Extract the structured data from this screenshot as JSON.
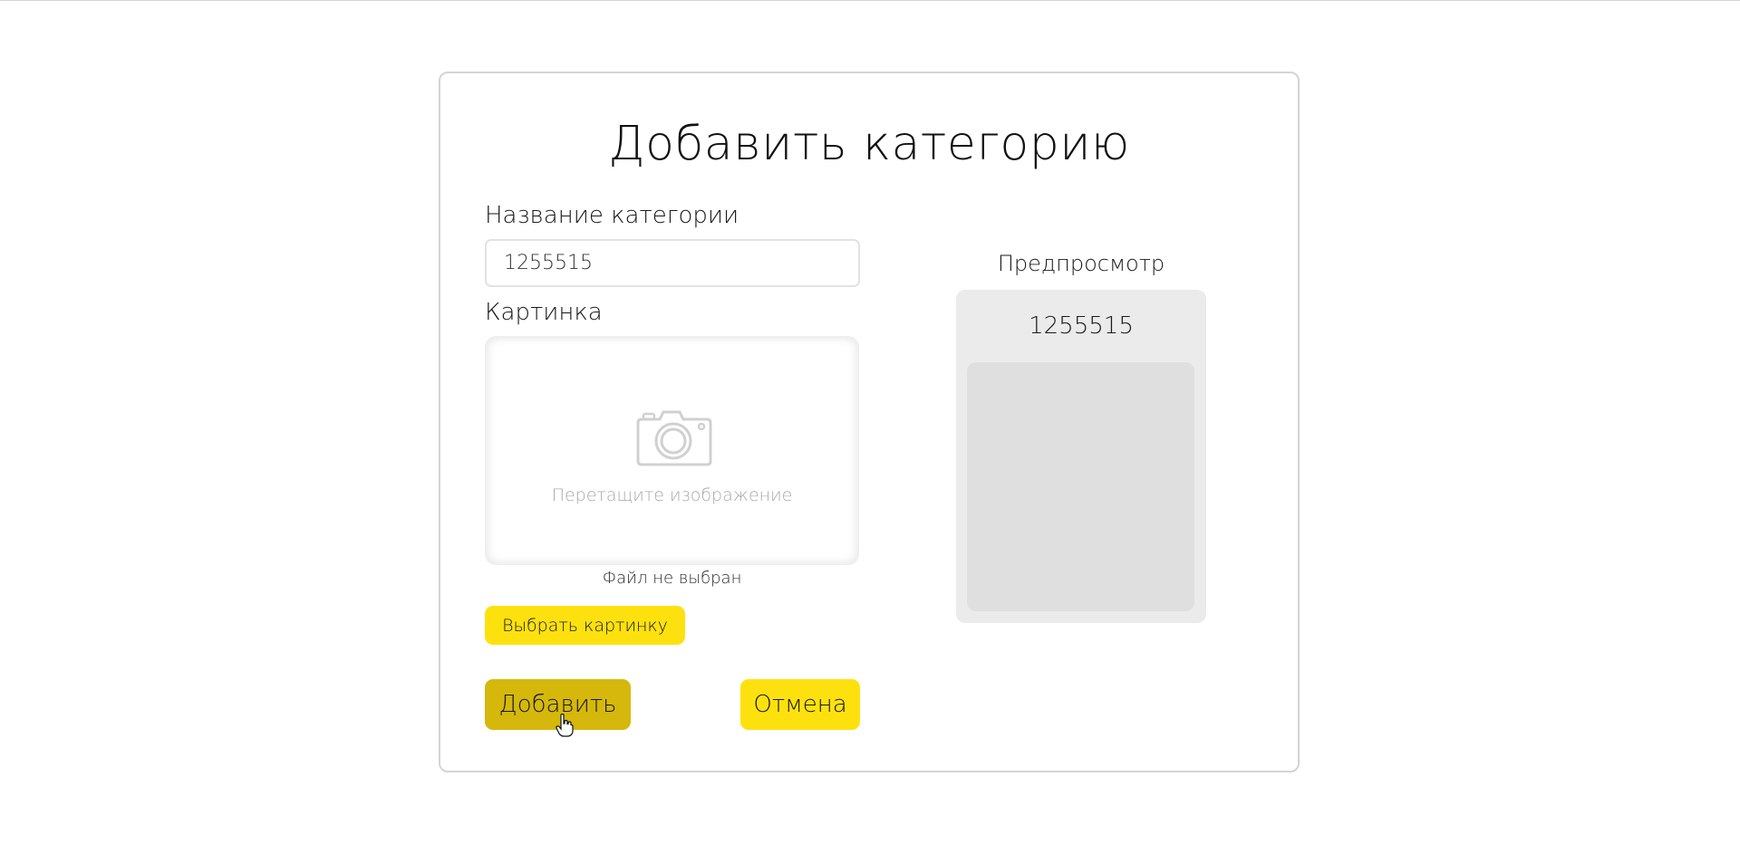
{
  "form": {
    "title": "Добавить категорию",
    "name_label": "Название категории",
    "name_value": "1255515",
    "image_label": "Картинка",
    "dropzone_text": "Перетащите изображение",
    "file_status": "Файл не выбран",
    "choose_button": "Выбрать картинку",
    "add_button": "Добавить",
    "cancel_button": "Отмена"
  },
  "preview": {
    "label": "Предпросмотр",
    "name": "1255515"
  },
  "colors": {
    "accent_yellow": "#fde10f",
    "accent_yellow_hover": "#d5b80b",
    "preview_bg": "#ebebeb",
    "preview_image_bg": "#dfdfdf"
  },
  "icons": {
    "dropzone": "camera-icon",
    "cursor": "hand-pointer-cursor"
  }
}
